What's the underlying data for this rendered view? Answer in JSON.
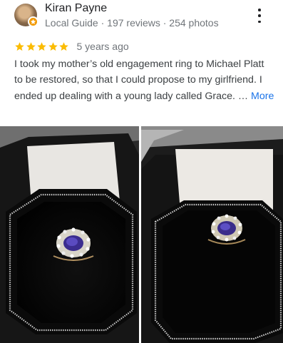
{
  "reviewer": {
    "name": "Kiran Payne",
    "meta": "Local Guide · 197 reviews · 254 photos",
    "avatar_icon": "profile-photo",
    "badge_icon": "local-guide-star-icon"
  },
  "rating": {
    "stars": 5,
    "max": 5,
    "star_color": "#fbbc04",
    "time_ago": "5 years ago"
  },
  "review": {
    "text": "I took my mother’s old engagement ring to Michael Platt to be restored, so that I could propose to my girlfriend. I ended up dealing with a young lady called Grace. … ",
    "more_label": "More"
  },
  "menu": {
    "icon": "more-vert-icon"
  },
  "photos": [
    {
      "subject": "ring in black box"
    },
    {
      "subject": "ring in black box"
    }
  ],
  "colors": {
    "link": "#1a73e8",
    "secondary_text": "#70757a"
  }
}
